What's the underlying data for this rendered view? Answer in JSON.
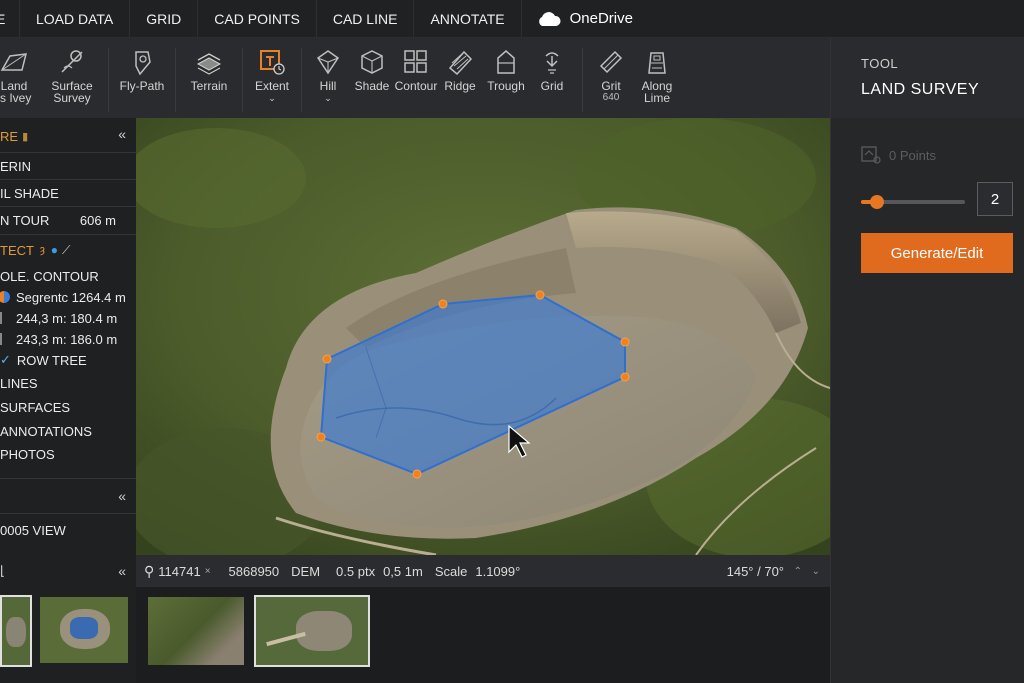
{
  "menubar": {
    "first_fragment": "E",
    "items": [
      "LOAD DATA",
      "GRID",
      "CAD POINTS",
      "CAD LINE",
      "ANNOTATE"
    ],
    "onedrive_label": "OneDrive"
  },
  "toolbar": {
    "tools": [
      {
        "label": "Land",
        "sub": "ts Ivey",
        "icon": "land-icon"
      },
      {
        "label": "Surface",
        "sub": "Survey",
        "icon": "surface-survey-icon"
      },
      {
        "label": "Fly-Path",
        "sub": "",
        "icon": "fly-path-icon"
      },
      {
        "label": "Terrain",
        "sub": "",
        "icon": "terrain-icon"
      },
      {
        "label": "Extent",
        "sub": "",
        "icon": "extent-icon"
      },
      {
        "label": "Hill",
        "sub": "",
        "icon": "hill-icon"
      },
      {
        "label": "Shade",
        "sub": "",
        "icon": "shade-icon"
      },
      {
        "label": "Contour",
        "sub": "",
        "icon": "contour-icon"
      },
      {
        "label": "Ridge",
        "sub": "",
        "icon": "ridge-icon"
      },
      {
        "label": "Trough",
        "sub": "",
        "icon": "trough-icon"
      },
      {
        "label": "Grid",
        "sub": "",
        "icon": "grid-icon"
      },
      {
        "label": "Grit",
        "sub": "640",
        "icon": "grit-icon"
      },
      {
        "label": "Along",
        "sub": "Lime",
        "icon": "along-line-icon"
      }
    ]
  },
  "left_panel": {
    "section_title": "RE",
    "rows": [
      {
        "label": "ERIN"
      },
      {
        "label": "IL SHADE"
      },
      {
        "label": "N TOUR",
        "value": "606 m"
      }
    ],
    "section2_title": "TECT",
    "contour": "OLE. CONTOUR",
    "segments": [
      {
        "label": "Segrentc 1264.4 m"
      },
      {
        "label": "244,3 m: 180.4 m"
      },
      {
        "label": "243,3 m: 186.0 m"
      }
    ],
    "row_tree": "ROW TREE",
    "layers": [
      "LINES",
      "SURFACES",
      "ANNOTATIONS",
      "PHOTOS"
    ],
    "view_label": "0005 VIEW",
    "collapse_symbol": "«"
  },
  "statusbar": {
    "coord_x": "114741",
    "coord_x_suffix": "×",
    "coord_y": "5868950",
    "mode": "DEM",
    "ptx": "0.5 ptx",
    "meters": "0,5 1m",
    "scale_label": "Scale",
    "scale_value": "1.1099°",
    "angle": "145° / 70°"
  },
  "right_panel": {
    "tool_label": "TOOL",
    "title": "LAND SURVEY",
    "points_label": "0 Points",
    "slider_value": 2,
    "slider_fraction": 0.15,
    "generate_label": "Generate/Edit"
  },
  "colors": {
    "accent": "#e06b1f",
    "polygon_fill": "#3a7bd5",
    "vertex": "#f0821e",
    "section_label": "#e09a3c"
  }
}
